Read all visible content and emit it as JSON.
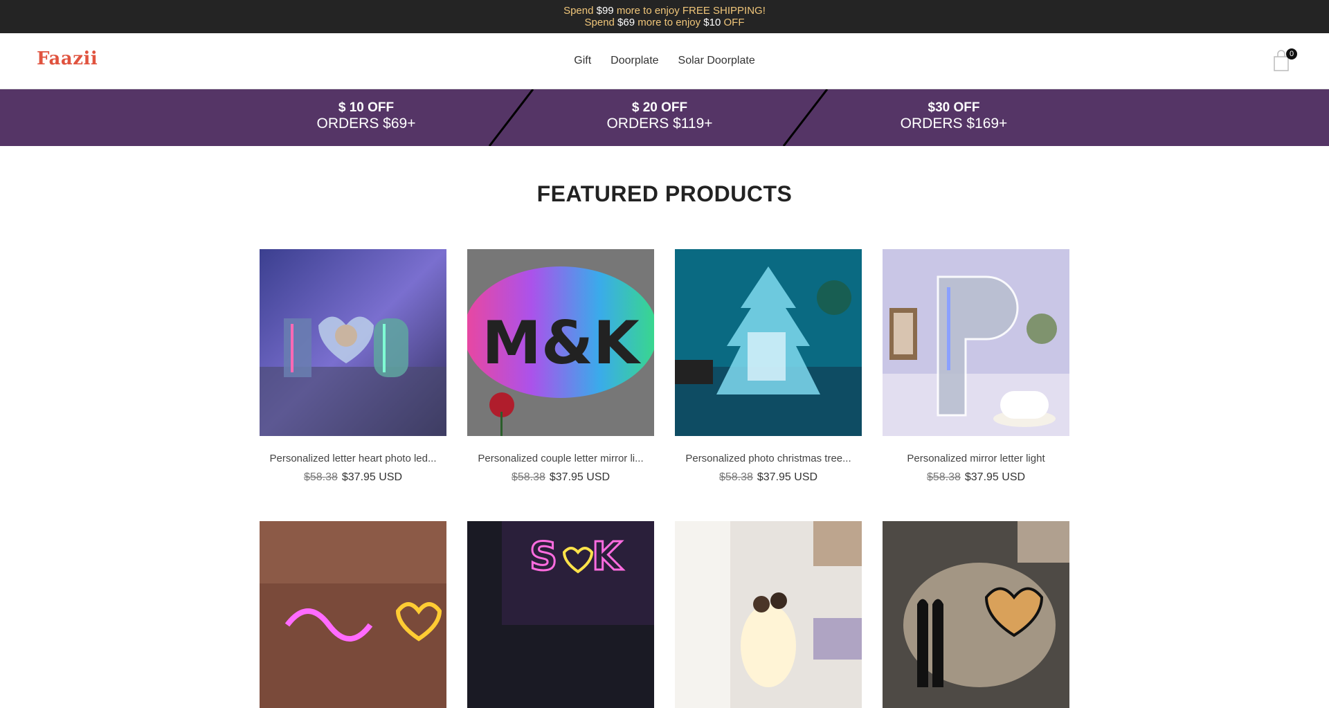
{
  "announcement": {
    "line1_a": "Spend ",
    "line1_b": "$99",
    "line1_c": " more to enjoy FREE SHIPPING!",
    "line2_a": "Spend ",
    "line2_b": "$69",
    "line2_c": " more to enjoy ",
    "line2_d": "$10",
    "line2_e": " OFF"
  },
  "header": {
    "logo": "Faazii",
    "nav": [
      "Gift",
      "Doorplate",
      "Solar Doorplate"
    ],
    "cart_count": "0"
  },
  "promo": [
    {
      "amount": "$ 10 OFF",
      "orders": "ORDERS $69+"
    },
    {
      "amount": "$ 20 OFF",
      "orders": "ORDERS $119+"
    },
    {
      "amount": "$30 OFF",
      "orders": "ORDERS $169+"
    }
  ],
  "featured": {
    "title": "FEATURED PRODUCTS",
    "products": [
      {
        "title": "Personalized letter heart photo led...",
        "old_price": "$58.38",
        "new_price": "$37.95 USD",
        "image": "letter-heart-photo-light"
      },
      {
        "title": "Personalized couple letter mirror li...",
        "old_price": "$58.38",
        "new_price": "$37.95 USD",
        "image": "couple-letter-mirror-light"
      },
      {
        "title": "Personalized photo christmas tree...",
        "old_price": "$58.38",
        "new_price": "$37.95 USD",
        "image": "christmas-tree-photo-light"
      },
      {
        "title": "Personalized mirror letter light",
        "old_price": "$58.38",
        "new_price": "$37.95 USD",
        "image": "mirror-letter-light"
      },
      {
        "title": "",
        "old_price": "",
        "new_price": "",
        "image": "neon-name-sign"
      },
      {
        "title": "",
        "old_price": "",
        "new_price": "",
        "image": "neon-initials-sign"
      },
      {
        "title": "",
        "old_price": "",
        "new_price": "",
        "image": "couple-photo-lamp"
      },
      {
        "title": "",
        "old_price": "",
        "new_price": "",
        "image": "couple-silhouette-wall-light"
      }
    ]
  },
  "colors": {
    "announce_bg": "#242424",
    "announce_text": "#f0c67a",
    "logo": "#e0533f",
    "promo_bg": "#553566"
  }
}
